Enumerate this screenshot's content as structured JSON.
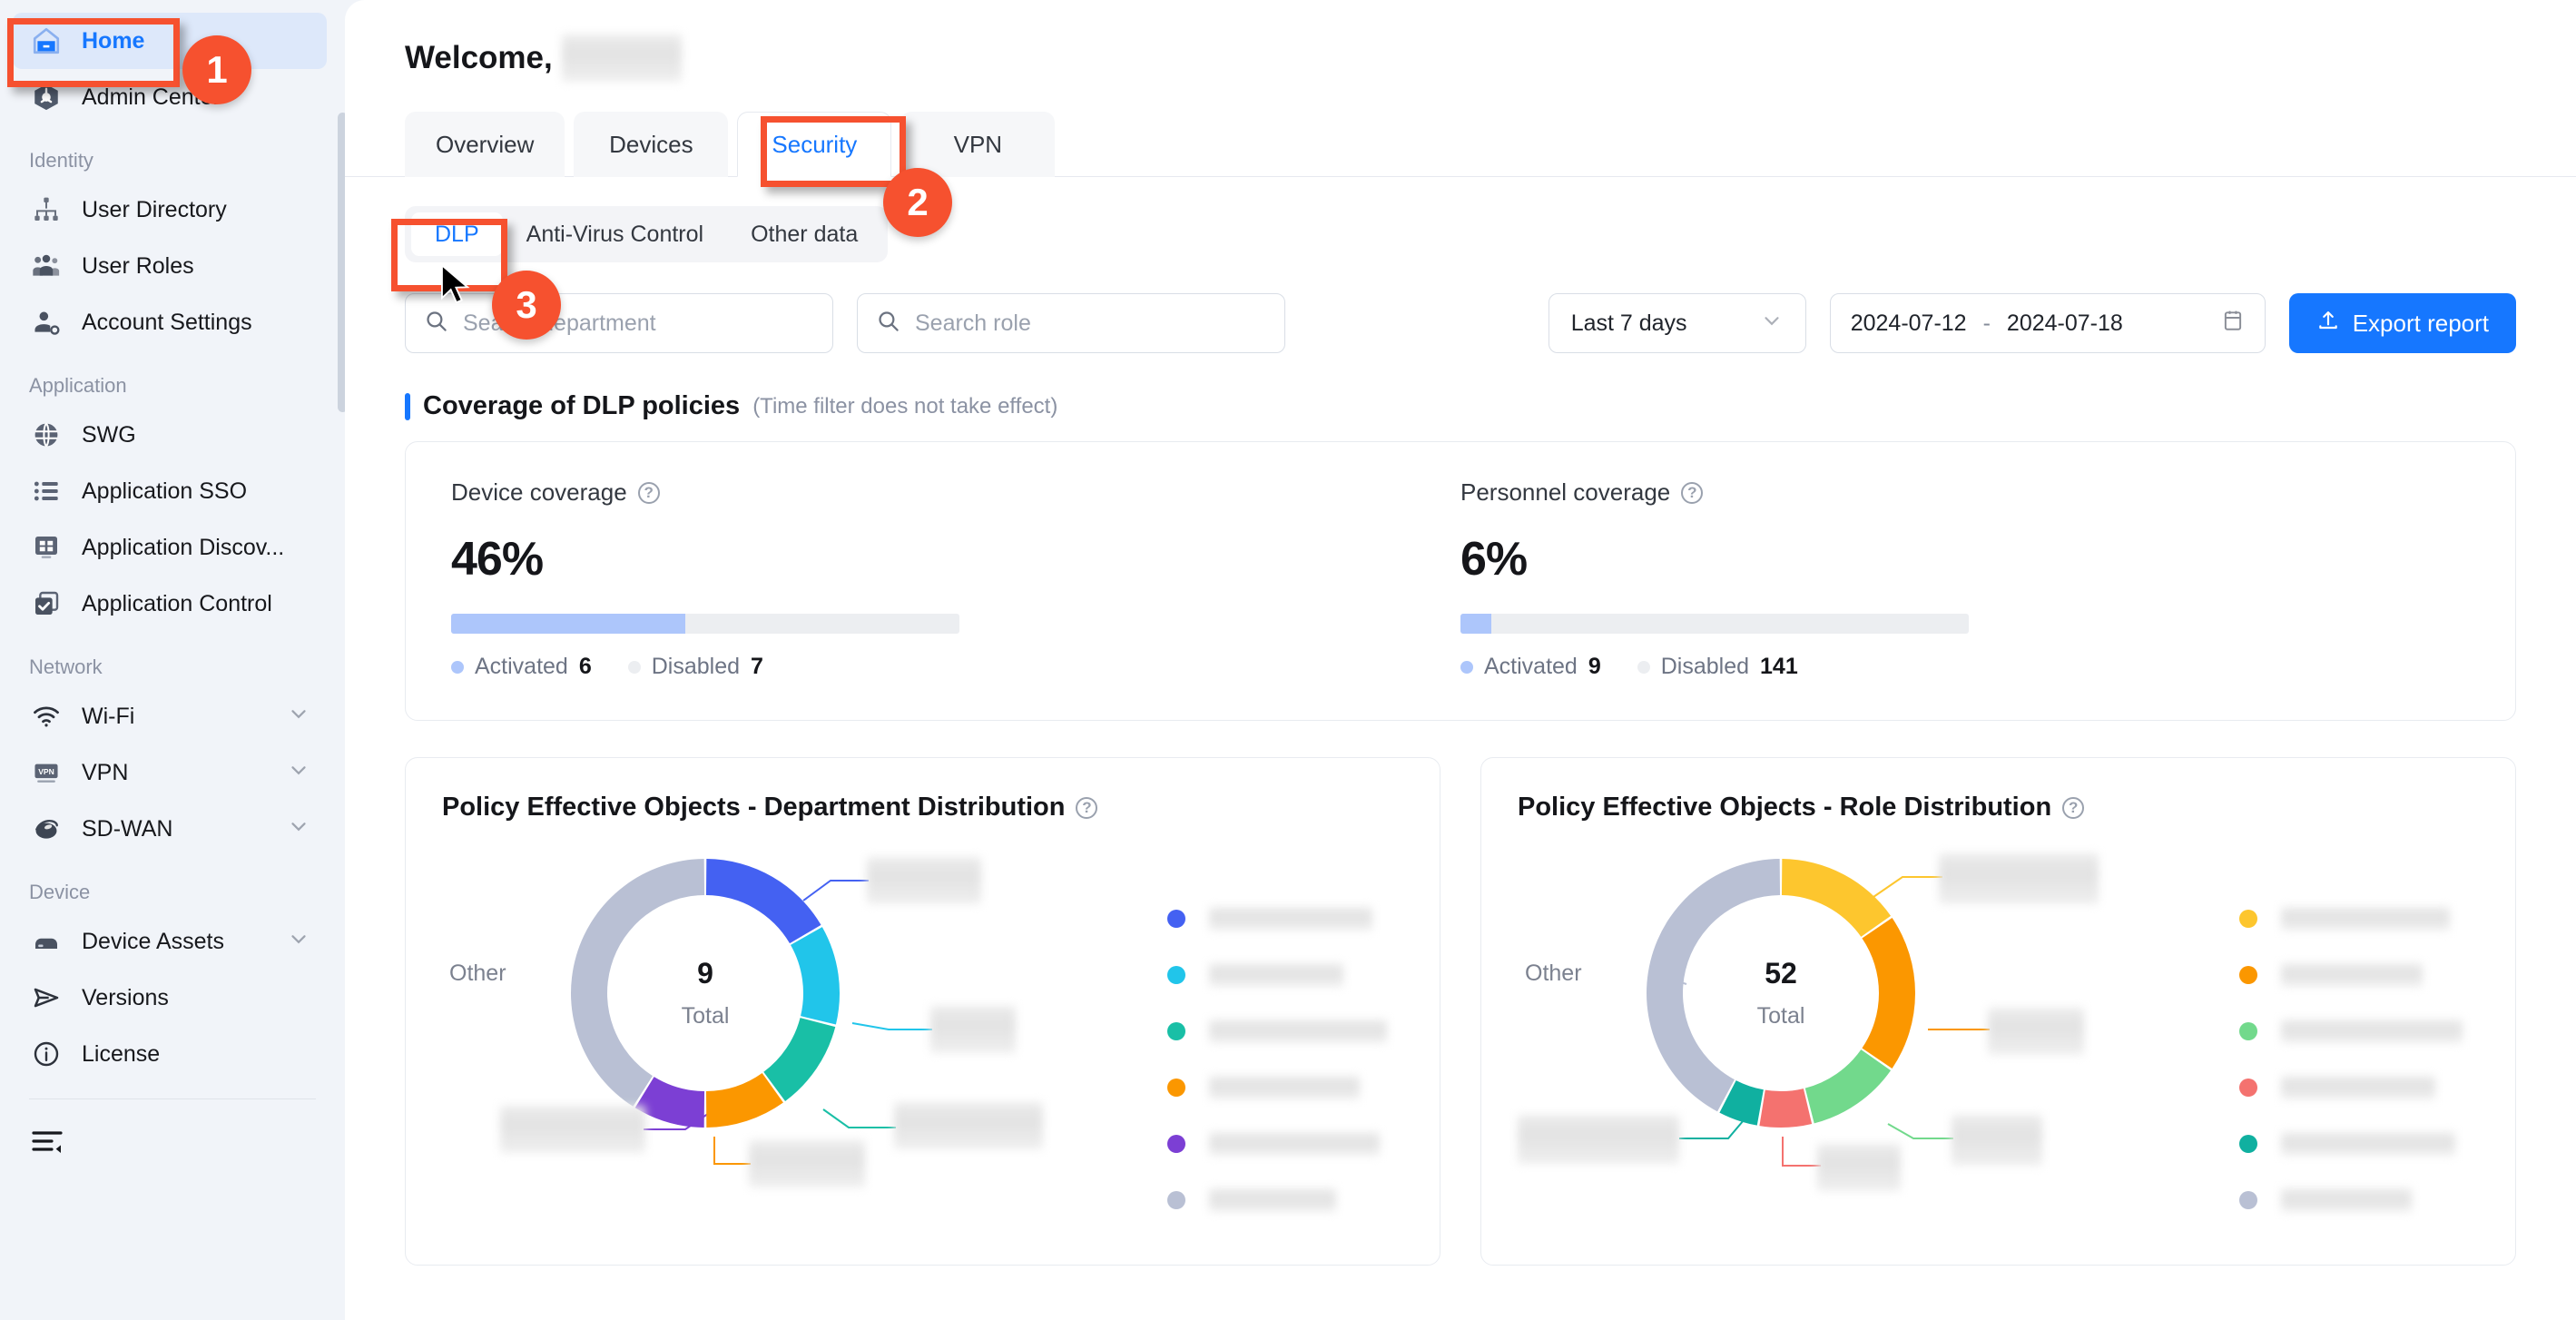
{
  "sidebar": {
    "top_items": [
      {
        "label": "Home",
        "icon": "home-icon",
        "active": true
      },
      {
        "label": "Admin Center",
        "icon": "admin-center-icon",
        "active": false
      }
    ],
    "groups": [
      {
        "title": "Identity",
        "items": [
          {
            "label": "User Directory",
            "icon": "org-tree-icon",
            "chevron": false
          },
          {
            "label": "User Roles",
            "icon": "users-icon",
            "chevron": false
          },
          {
            "label": "Account Settings",
            "icon": "user-gear-icon",
            "chevron": false
          }
        ]
      },
      {
        "title": "Application",
        "items": [
          {
            "label": "SWG",
            "icon": "globe-icon",
            "chevron": false
          },
          {
            "label": "Application SSO",
            "icon": "list-icon",
            "chevron": false
          },
          {
            "label": "Application Discov...",
            "icon": "app-grid-icon",
            "chevron": false
          },
          {
            "label": "Application Control",
            "icon": "checkbox-copy-icon",
            "chevron": false
          }
        ]
      },
      {
        "title": "Network",
        "items": [
          {
            "label": "Wi-Fi",
            "icon": "wifi-icon",
            "chevron": true
          },
          {
            "label": "VPN",
            "icon": "vpn-badge-icon",
            "chevron": true
          },
          {
            "label": "SD-WAN",
            "icon": "sdwan-icon",
            "chevron": true
          }
        ]
      },
      {
        "title": "Device",
        "items": [
          {
            "label": "Device Assets",
            "icon": "server-icon",
            "chevron": true
          },
          {
            "label": "Versions",
            "icon": "send-icon",
            "chevron": false
          },
          {
            "label": "License",
            "icon": "info-icon",
            "chevron": false
          }
        ]
      }
    ],
    "collapse_icon": "collapse-sidebar-icon"
  },
  "header": {
    "welcome": "Welcome,"
  },
  "tabs": [
    {
      "label": "Overview",
      "active": false
    },
    {
      "label": "Devices",
      "active": false
    },
    {
      "label": "Security",
      "active": true
    },
    {
      "label": "VPN",
      "active": false
    }
  ],
  "subtabs": [
    {
      "label": "DLP",
      "active": true
    },
    {
      "label": "Anti-Virus Control",
      "active": false
    },
    {
      "label": "Other data",
      "active": false
    }
  ],
  "filters": {
    "search_department_placeholder": "Search department",
    "search_role_placeholder": "Search role",
    "range_preset": "Last 7 days",
    "date_start": "2024-07-12",
    "date_separator": "-",
    "date_end": "2024-07-18",
    "export_label": "Export report"
  },
  "coverage_section": {
    "title": "Coverage of DLP policies",
    "note": "(Time filter does not take effect)",
    "cards": [
      {
        "title": "Device coverage",
        "percent_label": "46%",
        "percent_value": 46,
        "legend": [
          {
            "label": "Activated",
            "value": "6",
            "color": "#adc6fb"
          },
          {
            "label": "Disabled",
            "value": "7",
            "color": "#eceef1"
          }
        ]
      },
      {
        "title": "Personnel coverage",
        "percent_label": "6%",
        "percent_value": 6,
        "legend": [
          {
            "label": "Activated",
            "value": "9",
            "color": "#adc6fb"
          },
          {
            "label": "Disabled",
            "value": "141",
            "color": "#eceef1"
          }
        ]
      }
    ]
  },
  "chart_data": [
    {
      "type": "pie",
      "title": "Policy Effective Objects - Department Distribution",
      "center_value": "9",
      "center_label": "Total",
      "other_label": "Other",
      "legend_position": "right",
      "categories": [
        "[redacted]",
        "[redacted]",
        "[redacted]",
        "[redacted]",
        "[redacted]",
        "Other"
      ],
      "values": [
        1.5,
        1.1,
        1.0,
        0.9,
        0.8,
        3.7
      ],
      "colors": [
        "#4461f2",
        "#21c5ea",
        "#19bfa6",
        "#fb9700",
        "#7c3fd4",
        "#b9c0d4"
      ]
    },
    {
      "type": "pie",
      "title": "Policy Effective Objects - Role Distribution",
      "center_value": "52",
      "center_label": "Total",
      "other_label": "Other",
      "legend_position": "right",
      "categories": [
        "[redacted]",
        "[redacted]",
        "[redacted]",
        "[redacted]",
        "[redacted]",
        "Other"
      ],
      "values": [
        8,
        10,
        6,
        3.4,
        2.6,
        22
      ],
      "colors": [
        "#fdc62e",
        "#fb9700",
        "#72d98c",
        "#f4726f",
        "#10b0a0",
        "#b9c0d4"
      ]
    }
  ],
  "annotations": [
    {
      "number": "1"
    },
    {
      "number": "2"
    },
    {
      "number": "3"
    }
  ],
  "theme": {
    "accent": "#1677ff",
    "annotation": "#f6512f",
    "sidebar_bg": "#f1f4f9",
    "active_nav_bg": "#dde8fa"
  }
}
